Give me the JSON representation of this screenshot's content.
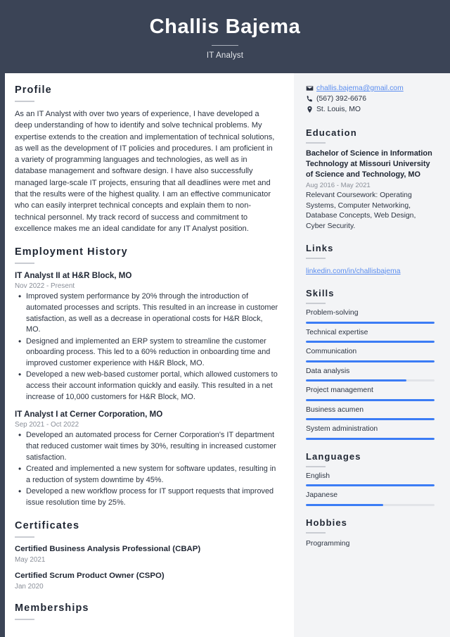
{
  "header": {
    "name": "Challis Bajema",
    "role": "IT Analyst"
  },
  "colors": {
    "header_bg": "#3b4456",
    "sidebar_bg": "#f3f4f6",
    "accent_blue": "#3b7cf5",
    "link_blue": "#5b8def",
    "text_dark": "#1f2633",
    "text_muted": "#8a8f99"
  },
  "main": {
    "profile": {
      "title": "Profile",
      "text": "As an IT Analyst with over two years of experience, I have developed a deep understanding of how to identify and solve technical problems. My expertise extends to the creation and implementation of technical solutions, as well as the development of IT policies and procedures. I am proficient in a variety of programming languages and technologies, as well as in database management and software design. I have also successfully managed large-scale IT projects, ensuring that all deadlines were met and that the results were of the highest quality. I am an effective communicator who can easily interpret technical concepts and explain them to non-technical personnel. My track record of success and commitment to excellence makes me an ideal candidate for any IT Analyst position."
    },
    "employment": {
      "title": "Employment History",
      "jobs": [
        {
          "title": "IT Analyst II at H&R Block, MO",
          "date": "Nov 2022 - Present",
          "bullets": [
            "Improved system performance by 20% through the introduction of automated processes and scripts. This resulted in an increase in customer satisfaction, as well as a decrease in operational costs for H&R Block, MO.",
            "Designed and implemented an ERP system to streamline the customer onboarding process. This led to a 60% reduction in onboarding time and improved customer experience with H&R Block, MO.",
            "Developed a new web-based customer portal, which allowed customers to access their account information quickly and easily. This resulted in a net increase of 10,000 customers for H&R Block, MO."
          ]
        },
        {
          "title": "IT Analyst I at Cerner Corporation, MO",
          "date": "Sep 2021 - Oct 2022",
          "bullets": [
            "Developed an automated process for Cerner Corporation's IT department that reduced customer wait times by 30%, resulting in increased customer satisfaction.",
            "Created and implemented a new system for software updates, resulting in a reduction of system downtime by 45%.",
            "Developed a new workflow process for IT support requests that improved issue resolution time by 25%."
          ]
        }
      ]
    },
    "certificates": {
      "title": "Certificates",
      "items": [
        {
          "title": "Certified Business Analysis Professional (CBAP)",
          "date": "May 2021"
        },
        {
          "title": "Certified Scrum Product Owner (CSPO)",
          "date": "Jan 2020"
        }
      ]
    },
    "memberships": {
      "title": "Memberships"
    }
  },
  "sidebar": {
    "contact": [
      {
        "icon": "envelope-icon",
        "text": "challis.bajema@gmail.com",
        "is_link": true
      },
      {
        "icon": "phone-icon",
        "text": "(567) 392-6676",
        "is_link": false
      },
      {
        "icon": "location-pin-icon",
        "text": "St. Louis, MO",
        "is_link": false
      }
    ],
    "education": {
      "title": "Education",
      "degree": "Bachelor of Science in Information Technology at Missouri University of Science and Technology, MO",
      "date": "Aug 2016 - May 2021",
      "description": "Relevant Coursework: Operating Systems, Computer Networking, Database Concepts, Web Design, Cyber Security."
    },
    "links": {
      "title": "Links",
      "items": [
        {
          "label": "linkedin.com/in/challisbajema"
        }
      ]
    },
    "skills": {
      "title": "Skills",
      "items": [
        {
          "label": "Problem-solving",
          "level": 100
        },
        {
          "label": "Technical expertise",
          "level": 100
        },
        {
          "label": "Communication",
          "level": 100
        },
        {
          "label": "Data analysis",
          "level": 78
        },
        {
          "label": "Project management",
          "level": 100
        },
        {
          "label": "Business acumen",
          "level": 100
        },
        {
          "label": "System administration",
          "level": 100
        }
      ]
    },
    "languages": {
      "title": "Languages",
      "items": [
        {
          "label": "English",
          "level": 100
        },
        {
          "label": "Japanese",
          "level": 60
        }
      ]
    },
    "hobbies": {
      "title": "Hobbies",
      "items": [
        {
          "label": "Programming"
        }
      ]
    }
  }
}
